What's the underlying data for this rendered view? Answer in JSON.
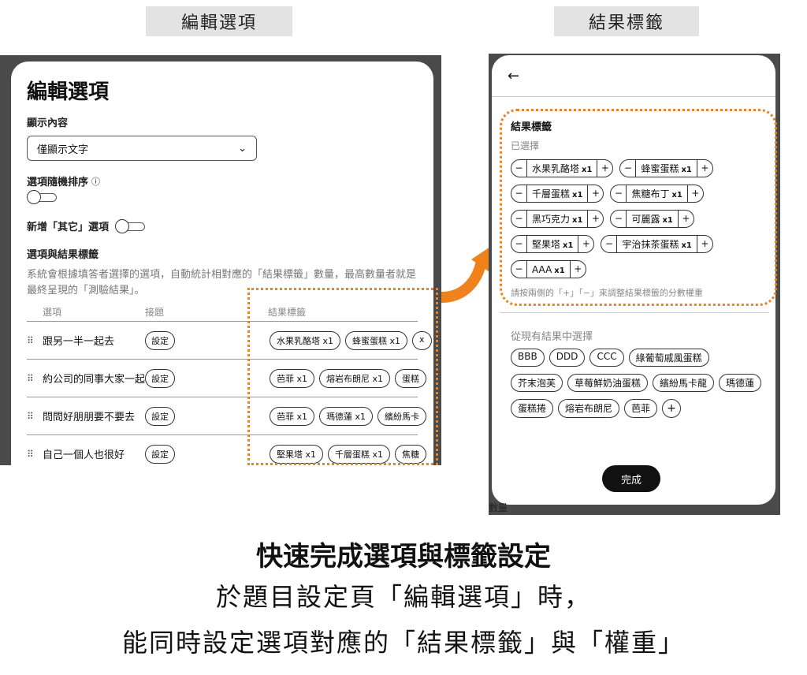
{
  "captions": {
    "left": "編輯選項",
    "right": "結果標籤"
  },
  "left": {
    "title": "編輯選項",
    "display_label": "顯示內容",
    "display_value": "僅顯示文字",
    "random_label": "選項隨機排序",
    "random_info": "ⓘ",
    "other_label": "新增「其它」選項",
    "map_title": "選項與結果標籤",
    "map_desc": "系統會根據填答者選擇的選項，自動統計相對應的「結果標籤」數量，最高數量者就是最終呈現的「測驗結果」。",
    "columns": [
      "選項",
      "接題",
      "結果標籤"
    ],
    "set_label": "設定",
    "rows": [
      {
        "option": "跟另一半一起去",
        "tags": [
          "水果乳酪塔 x1",
          "蜂蜜蛋糕 x1",
          "x"
        ]
      },
      {
        "option": "約公司的同事大家一起",
        "tags": [
          "芭菲 x1",
          "熔岩布朗尼 x1",
          "蛋糕"
        ]
      },
      {
        "option": "問問好朋朋要不要去",
        "tags": [
          "芭菲 x1",
          "瑪德蓮 x1",
          "繽紛馬卡"
        ]
      },
      {
        "option": "自己一個人也很好",
        "tags": [
          "堅果塔 x1",
          "千層蛋糕 x1",
          "焦糖"
        ]
      }
    ]
  },
  "right": {
    "back_icon": "←",
    "label": "結果標籤",
    "selected_label": "已選擇",
    "selected": [
      {
        "name": "水果乳酪塔",
        "count": "x1"
      },
      {
        "name": "蜂蜜蛋糕",
        "count": "x1"
      },
      {
        "name": "千層蛋糕",
        "count": "x1"
      },
      {
        "name": "焦糖布丁",
        "count": "x1"
      },
      {
        "name": "黑巧克力",
        "count": "x1"
      },
      {
        "name": "可麗露",
        "count": "x1"
      },
      {
        "name": "堅果塔",
        "count": "x1"
      },
      {
        "name": "宇治抹茶蛋糕",
        "count": "x1"
      },
      {
        "name": "AAA",
        "count": "x1"
      }
    ],
    "minus": "−",
    "plus": "+",
    "hint": "請按兩側的「+」「−」來調整結果標籤的分數權重",
    "existing_label": "從現有結果中選擇",
    "existing": [
      "BBB",
      "DDD",
      "CCC",
      "綠葡萄戚風蛋糕",
      "芥末泡芙",
      "草莓鮮奶油蛋糕",
      "繽紛馬卡龍",
      "瑪德蓮",
      "蛋糕捲",
      "熔岩布朗尼",
      "芭菲"
    ],
    "add_icon": "+",
    "done": "完成",
    "corner_text": "數量"
  },
  "footer": {
    "headline": "快速完成選項與標籤設定",
    "line2": "於題目設定頁「編輯選項」時，",
    "line3": "能同時設定選項對應的「結果標籤」與「權重」"
  },
  "colors": {
    "highlight": "#f0821e",
    "done_button": "#111111"
  }
}
